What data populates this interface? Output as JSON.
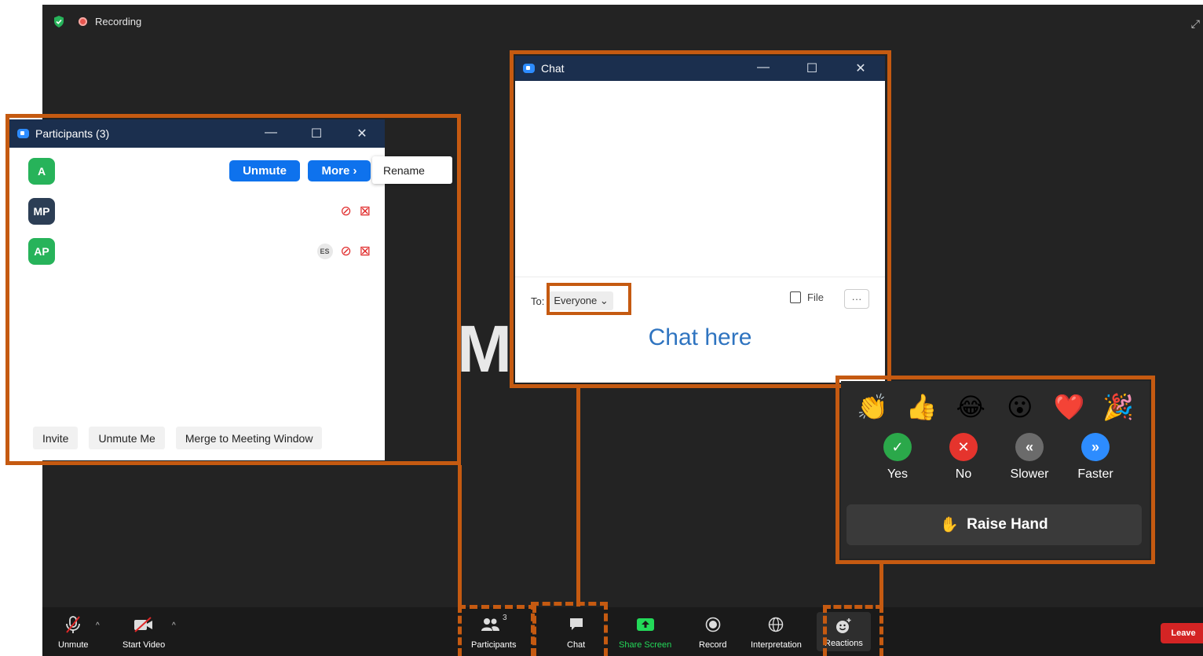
{
  "meeting": {
    "recording_label": "Recording",
    "background_text": "MI"
  },
  "participants_window": {
    "title": "Participants (3)",
    "rows": [
      {
        "initials": "A",
        "color": "#27b35a"
      },
      {
        "initials": "MP",
        "color": "#2c3e55"
      },
      {
        "initials": "AP",
        "color": "#27b35a",
        "badge": "ES"
      }
    ],
    "unmute_label": "Unmute",
    "more_label": "More ›",
    "rename_label": "Rename",
    "footer": {
      "invite": "Invite",
      "unmute_me": "Unmute Me",
      "merge": "Merge to Meeting Window"
    }
  },
  "chat_window": {
    "title": "Chat",
    "to_label": "To:",
    "recipient": "Everyone",
    "file_label": "File",
    "more_label": "···",
    "hint": "Chat here"
  },
  "reactions": {
    "emojis": [
      "👏",
      "👍",
      "😂",
      "😮",
      "❤️",
      "🎉"
    ],
    "feedback": [
      {
        "label": "Yes",
        "symbol": "✓",
        "color": "#2ba84a"
      },
      {
        "label": "No",
        "symbol": "✕",
        "color": "#e5342d"
      },
      {
        "label": "Slower",
        "symbol": "«",
        "color": "#6b6b6b"
      },
      {
        "label": "Faster",
        "symbol": "»",
        "color": "#2d8cff"
      }
    ],
    "raise_hand": "Raise Hand",
    "raise_hand_icon": "✋"
  },
  "toolbar": {
    "unmute": "Unmute",
    "start_video": "Start Video",
    "participants": "Participants",
    "participants_count": "3",
    "chat": "Chat",
    "share_screen": "Share Screen",
    "record": "Record",
    "interpretation": "Interpretation",
    "reactions": "Reactions",
    "leave": "Leave"
  },
  "colors": {
    "accent": "#0e72ed",
    "highlight": "#c55a11",
    "share_green": "#23d959"
  }
}
